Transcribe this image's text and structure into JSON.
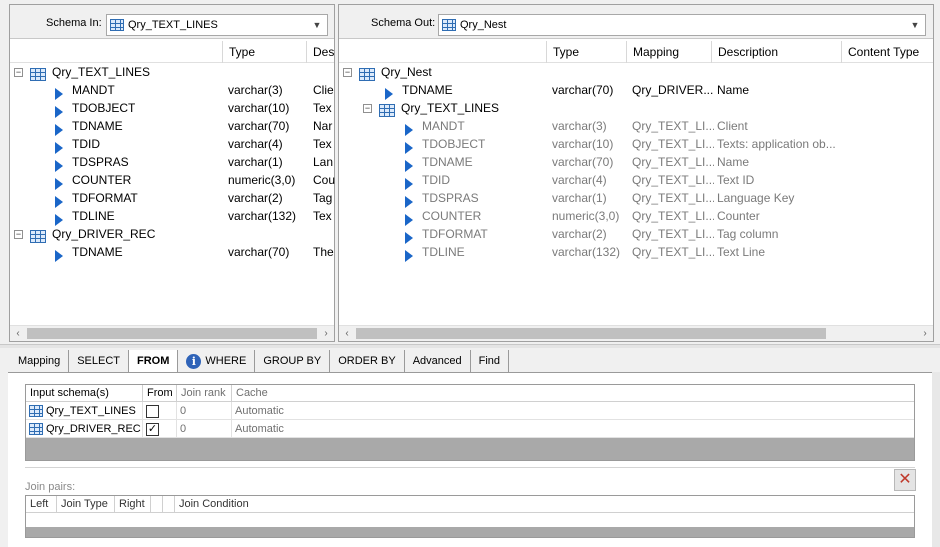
{
  "schema_in": {
    "label": "Schema In:",
    "value": "Qry_TEXT_LINES",
    "columns": [
      "Type",
      "Des"
    ],
    "rows": [
      {
        "kind": "table",
        "name": "Qry_TEXT_LINES",
        "type": "",
        "desc": ""
      },
      {
        "kind": "field",
        "name": "MANDT",
        "type": "varchar(3)",
        "desc": "Clie"
      },
      {
        "kind": "field",
        "name": "TDOBJECT",
        "type": "varchar(10)",
        "desc": "Tex"
      },
      {
        "kind": "field",
        "name": "TDNAME",
        "type": "varchar(70)",
        "desc": "Nar"
      },
      {
        "kind": "field",
        "name": "TDID",
        "type": "varchar(4)",
        "desc": "Tex"
      },
      {
        "kind": "field",
        "name": "TDSPRAS",
        "type": "varchar(1)",
        "desc": "Lan"
      },
      {
        "kind": "field",
        "name": "COUNTER",
        "type": "numeric(3,0)",
        "desc": "Cou"
      },
      {
        "kind": "field",
        "name": "TDFORMAT",
        "type": "varchar(2)",
        "desc": "Tag"
      },
      {
        "kind": "field",
        "name": "TDLINE",
        "type": "varchar(132)",
        "desc": "Tex"
      },
      {
        "kind": "table",
        "name": "Qry_DRIVER_REC",
        "type": "",
        "desc": ""
      },
      {
        "kind": "field",
        "name": "TDNAME",
        "type": "varchar(70)",
        "desc": "The"
      }
    ]
  },
  "schema_out": {
    "label": "Schema Out:",
    "value": "Qry_Nest",
    "columns": [
      "Type",
      "Mapping",
      "Description",
      "Content Type"
    ],
    "rows": [
      {
        "kind": "root",
        "name": "Qry_Nest",
        "type": "",
        "mapping": "",
        "desc": "",
        "dim": false
      },
      {
        "kind": "field1",
        "name": "TDNAME",
        "type": "varchar(70)",
        "mapping": "Qry_DRIVER...",
        "desc": "Name",
        "dim": false
      },
      {
        "kind": "nested",
        "name": "Qry_TEXT_LINES",
        "type": "",
        "mapping": "",
        "desc": "",
        "dim": false
      },
      {
        "kind": "field2",
        "name": "MANDT",
        "type": "varchar(3)",
        "mapping": "Qry_TEXT_LI...",
        "desc": "Client",
        "dim": true
      },
      {
        "kind": "field2",
        "name": "TDOBJECT",
        "type": "varchar(10)",
        "mapping": "Qry_TEXT_LI...",
        "desc": "Texts: application ob...",
        "dim": true
      },
      {
        "kind": "field2",
        "name": "TDNAME",
        "type": "varchar(70)",
        "mapping": "Qry_TEXT_LI...",
        "desc": "Name",
        "dim": true
      },
      {
        "kind": "field2",
        "name": "TDID",
        "type": "varchar(4)",
        "mapping": "Qry_TEXT_LI...",
        "desc": "Text ID",
        "dim": true
      },
      {
        "kind": "field2",
        "name": "TDSPRAS",
        "type": "varchar(1)",
        "mapping": "Qry_TEXT_LI...",
        "desc": "Language Key",
        "dim": true
      },
      {
        "kind": "field2",
        "name": "COUNTER",
        "type": "numeric(3,0)",
        "mapping": "Qry_TEXT_LI...",
        "desc": "Counter",
        "dim": true
      },
      {
        "kind": "field2",
        "name": "TDFORMAT",
        "type": "varchar(2)",
        "mapping": "Qry_TEXT_LI...",
        "desc": "Tag column",
        "dim": true
      },
      {
        "kind": "field2",
        "name": "TDLINE",
        "type": "varchar(132)",
        "mapping": "Qry_TEXT_LI...",
        "desc": "Text Line",
        "dim": true
      }
    ]
  },
  "tabs": [
    {
      "label": "Mapping",
      "active": false,
      "info": false
    },
    {
      "label": "SELECT",
      "active": false,
      "info": false
    },
    {
      "label": "FROM",
      "active": true,
      "info": false
    },
    {
      "label": "WHERE",
      "active": false,
      "info": true
    },
    {
      "label": "GROUP BY",
      "active": false,
      "info": false
    },
    {
      "label": "ORDER BY",
      "active": false,
      "info": false
    },
    {
      "label": "Advanced",
      "active": false,
      "info": false
    },
    {
      "label": "Find",
      "active": false,
      "info": false
    }
  ],
  "input_table": {
    "headers": [
      "Input schema(s)",
      "From",
      "Join rank",
      "Cache"
    ],
    "rows": [
      {
        "schema": "Qry_TEXT_LINES",
        "from": false,
        "rank": "0",
        "cache": "Automatic"
      },
      {
        "schema": "Qry_DRIVER_REC",
        "from": true,
        "rank": "0",
        "cache": "Automatic"
      }
    ]
  },
  "join_pairs": {
    "label": "Join pairs:",
    "headers": [
      "Left",
      "Join Type",
      "Right",
      "",
      "",
      "Join Condition"
    ]
  }
}
